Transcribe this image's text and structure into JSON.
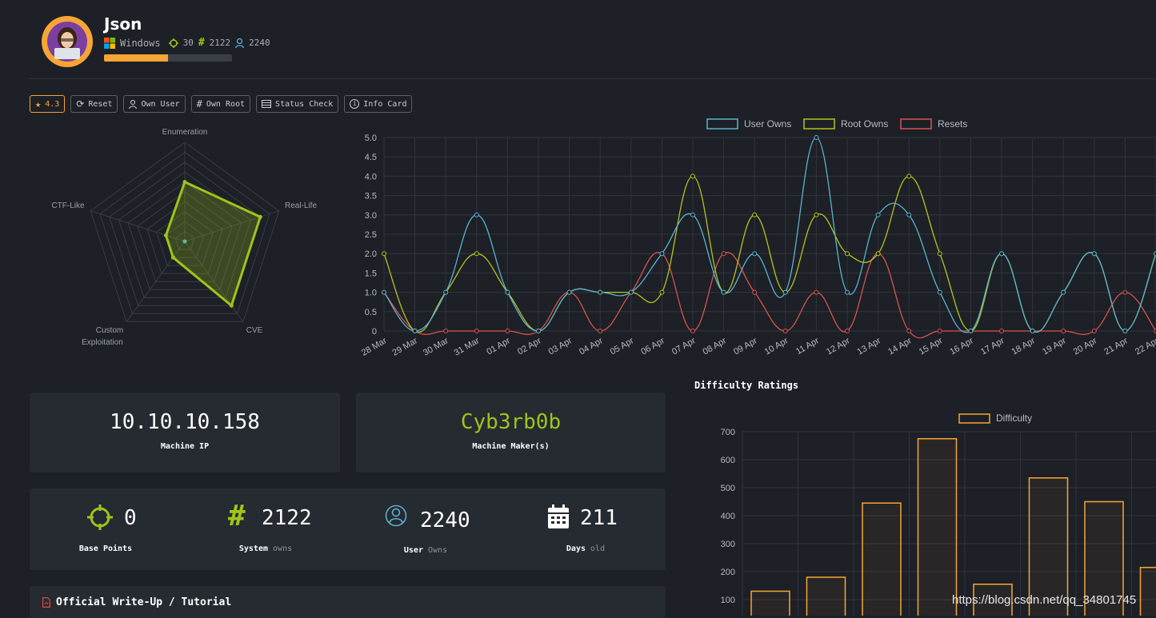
{
  "machine": {
    "name": "Json",
    "os": "Windows",
    "points": "30",
    "system_owns": "2122",
    "user_owns": "2240",
    "progress_fraction": 0.5
  },
  "toolbar": {
    "rating": "4.3",
    "reset": "Reset",
    "own_user": "Own User",
    "own_root": "Own Root",
    "status_check": "Status Check",
    "info_card": "Info Card"
  },
  "radar": {
    "axes": [
      "Enumeration",
      "Real-Life",
      "CVE",
      "Custom",
      "Exploitation",
      "CTF-Like"
    ],
    "values": [
      6,
      8,
      8,
      2,
      2
    ],
    "max": 10,
    "color": "#9fc41a"
  },
  "chart_data": [
    {
      "type": "line",
      "x": [
        "28 Mar",
        "29 Mar",
        "30 Mar",
        "31 Mar",
        "01 Apr",
        "02 Apr",
        "03 Apr",
        "04 Apr",
        "05 Apr",
        "06 Apr",
        "07 Apr",
        "08 Apr",
        "09 Apr",
        "10 Apr",
        "11 Apr",
        "12 Apr",
        "13 Apr",
        "14 Apr",
        "15 Apr",
        "16 Apr",
        "17 Apr",
        "18 Apr",
        "19 Apr",
        "20 Apr",
        "21 Apr",
        "22 Apr"
      ],
      "series": [
        {
          "name": "User Owns",
          "color": "#59b3d1",
          "values": [
            1,
            0,
            1,
            3,
            1,
            0,
            1,
            1,
            1,
            2,
            3,
            1,
            2,
            1,
            5,
            1,
            3,
            3,
            1,
            0,
            2,
            0,
            1,
            2,
            0,
            2
          ]
        },
        {
          "name": "Root Owns",
          "color": "#b3c41a",
          "values": [
            2,
            0,
            1,
            2,
            1,
            0,
            1,
            1,
            1,
            1,
            4,
            1,
            3,
            1,
            3,
            2,
            2,
            4,
            2,
            0,
            2,
            0,
            1,
            2,
            0,
            2
          ]
        },
        {
          "name": "Resets",
          "color": "#d9534f",
          "values": [
            1,
            0,
            0,
            0,
            0,
            0,
            1,
            0,
            1,
            2,
            0,
            2,
            1,
            0,
            1,
            0,
            2,
            0,
            0,
            0,
            0,
            0,
            0,
            0,
            1,
            0
          ]
        }
      ],
      "ylim": [
        0,
        5
      ],
      "yticks": [
        "0",
        "0.5",
        "1.0",
        "1.5",
        "2.0",
        "2.5",
        "3.0",
        "3.5",
        "4.0",
        "4.5",
        "5.0"
      ],
      "legend": "top"
    },
    {
      "type": "bar",
      "title": "Difficulty Ratings",
      "series": [
        {
          "name": "Difficulty",
          "color": "#f7a534",
          "values": [
            130,
            180,
            445,
            675,
            155,
            535,
            450,
            215
          ]
        }
      ],
      "ylim": [
        0,
        700
      ],
      "yticks": [
        "100",
        "200",
        "300",
        "400",
        "500",
        "600",
        "700"
      ],
      "legend": "top"
    }
  ],
  "info": {
    "ip": "10.10.10.158",
    "ip_label": "Machine IP",
    "maker": "Cyb3rb0b",
    "maker_label": "Machine Maker(s)"
  },
  "stats": {
    "base_points": "0",
    "base_points_label": "Base Points",
    "system": "2122",
    "system_label": "System",
    "system_sub": "owns",
    "user": "2240",
    "user_label": "User",
    "user_sub": "Owns",
    "days": "211",
    "days_label": "Days",
    "days_sub": "old"
  },
  "writeup": {
    "label": "Official Write-Up / Tutorial"
  },
  "watermark": "https://blog.csdn.net/qq_34801745",
  "colors": {
    "accent": "#f7a534",
    "green": "#9fc41a",
    "blue": "#59b3d1",
    "red": "#d9534f"
  }
}
